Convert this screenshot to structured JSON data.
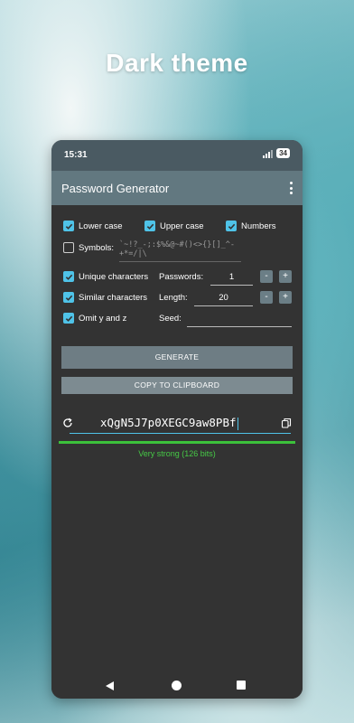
{
  "headline": "Dark theme",
  "status_bar": {
    "time": "15:31",
    "battery": "34"
  },
  "app_bar": {
    "title": "Password Generator"
  },
  "options": {
    "lower_case": {
      "label": "Lower case",
      "checked": true
    },
    "upper_case": {
      "label": "Upper case",
      "checked": true
    },
    "numbers": {
      "label": "Numbers",
      "checked": true
    },
    "symbols": {
      "label": "Symbols:",
      "checked": false,
      "value": "`~!?_-;:$%&@~#()<>{}[]_^-+*=/|\\"
    },
    "unique_characters": {
      "label": "Unique characters",
      "checked": true
    },
    "similar_characters": {
      "label": "Similar characters",
      "checked": true
    },
    "omit_y_and_z": {
      "label": "Omit y and z",
      "checked": true
    }
  },
  "settings": {
    "passwords_label": "Passwords:",
    "passwords_value": "1",
    "length_label": "Length:",
    "length_value": "20",
    "seed_label": "Seed:",
    "seed_value": "",
    "minus": "-",
    "plus": "+"
  },
  "buttons": {
    "generate": "GENERATE",
    "copy": "COPY TO CLIPBOARD"
  },
  "result": {
    "password": "xQgN5J7p0XEGC9aw8PBf",
    "strength": "Very strong (126 bits)"
  },
  "colors": {
    "accent": "#4fc3e8",
    "strength": "#3cc13b",
    "app_bar": "#627880",
    "background": "#333333"
  }
}
